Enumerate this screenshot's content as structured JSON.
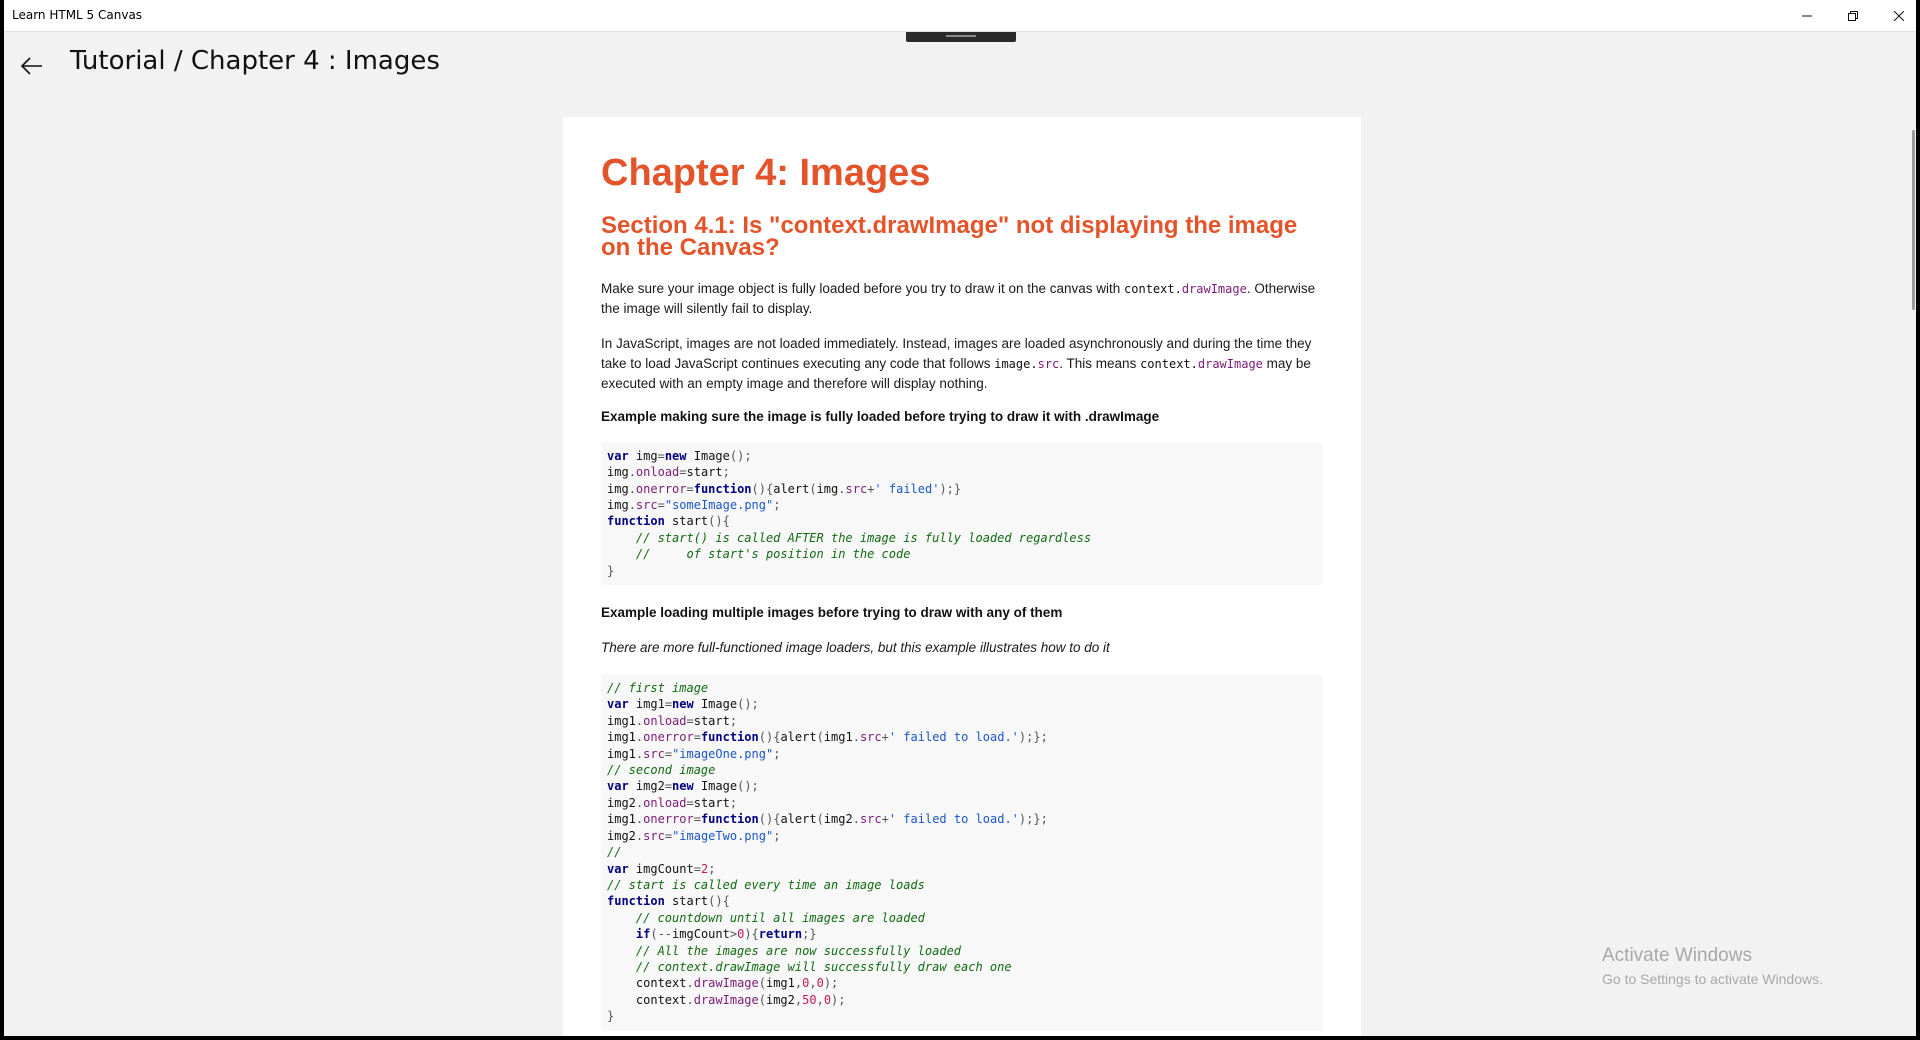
{
  "window": {
    "title": "Learn HTML 5 Canvas",
    "controls": {
      "minimize": "—",
      "maximize": "❐",
      "close": "✕"
    }
  },
  "header": {
    "back_icon": "arrow-left-icon",
    "title": "Tutorial / Chapter 4 :  Images"
  },
  "article": {
    "chapter_title": "Chapter 4: Images",
    "section_title": "Section 4.1: Is \"context.drawImage\" not displaying the image on the Canvas?",
    "p1_a": "Make sure your image object is fully loaded before you try to draw it on the canvas with ",
    "p1_code_obj": "context.",
    "p1_code_prop": "drawImage",
    "p1_b": ". Otherwise the image will silently fail to display.",
    "p2_a": "In JavaScript, images are not loaded immediately. Instead, images are loaded asynchronously and during the time they take to load JavaScript continues executing any code that follows ",
    "p2_code1_obj": "image.",
    "p2_code1_prop": "src",
    "p2_b": ". This means ",
    "p2_code2_obj": "context.",
    "p2_code2_prop": "drawImage",
    "p2_c": " may be executed with an empty image and therefore will display nothing.",
    "example1_heading": "Example making sure the image is fully loaded before trying to draw it with .drawImage",
    "example2_heading": "Example loading multiple images before trying to draw with any of them",
    "example2_note": "There are more full-functioned image loaders, but this example illustrates how to do it"
  },
  "watermark": {
    "line1": "Activate Windows",
    "line2": "Go to Settings to activate Windows."
  }
}
